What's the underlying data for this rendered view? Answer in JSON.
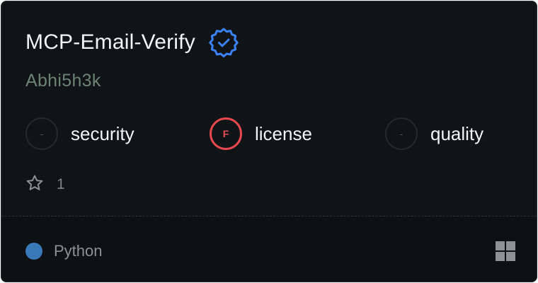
{
  "server": {
    "name": "MCP-Email-Verify",
    "author": "Abhi5h3k",
    "verified_icon": "verified-badge-icon"
  },
  "metrics": [
    {
      "label": "security",
      "grade": "-",
      "status": "none"
    },
    {
      "label": "license",
      "grade": "F",
      "status": "fail"
    },
    {
      "label": "quality",
      "grade": "-",
      "status": "none"
    }
  ],
  "stars": {
    "icon": "star-icon",
    "count": "1"
  },
  "language": {
    "name": "Python",
    "color": "#3a79b9"
  },
  "platform_icon": "windows-icon",
  "colors": {
    "background": "#111416",
    "verified": "#3b82f6",
    "fail": "#e5484d",
    "author": "#6c8275"
  }
}
